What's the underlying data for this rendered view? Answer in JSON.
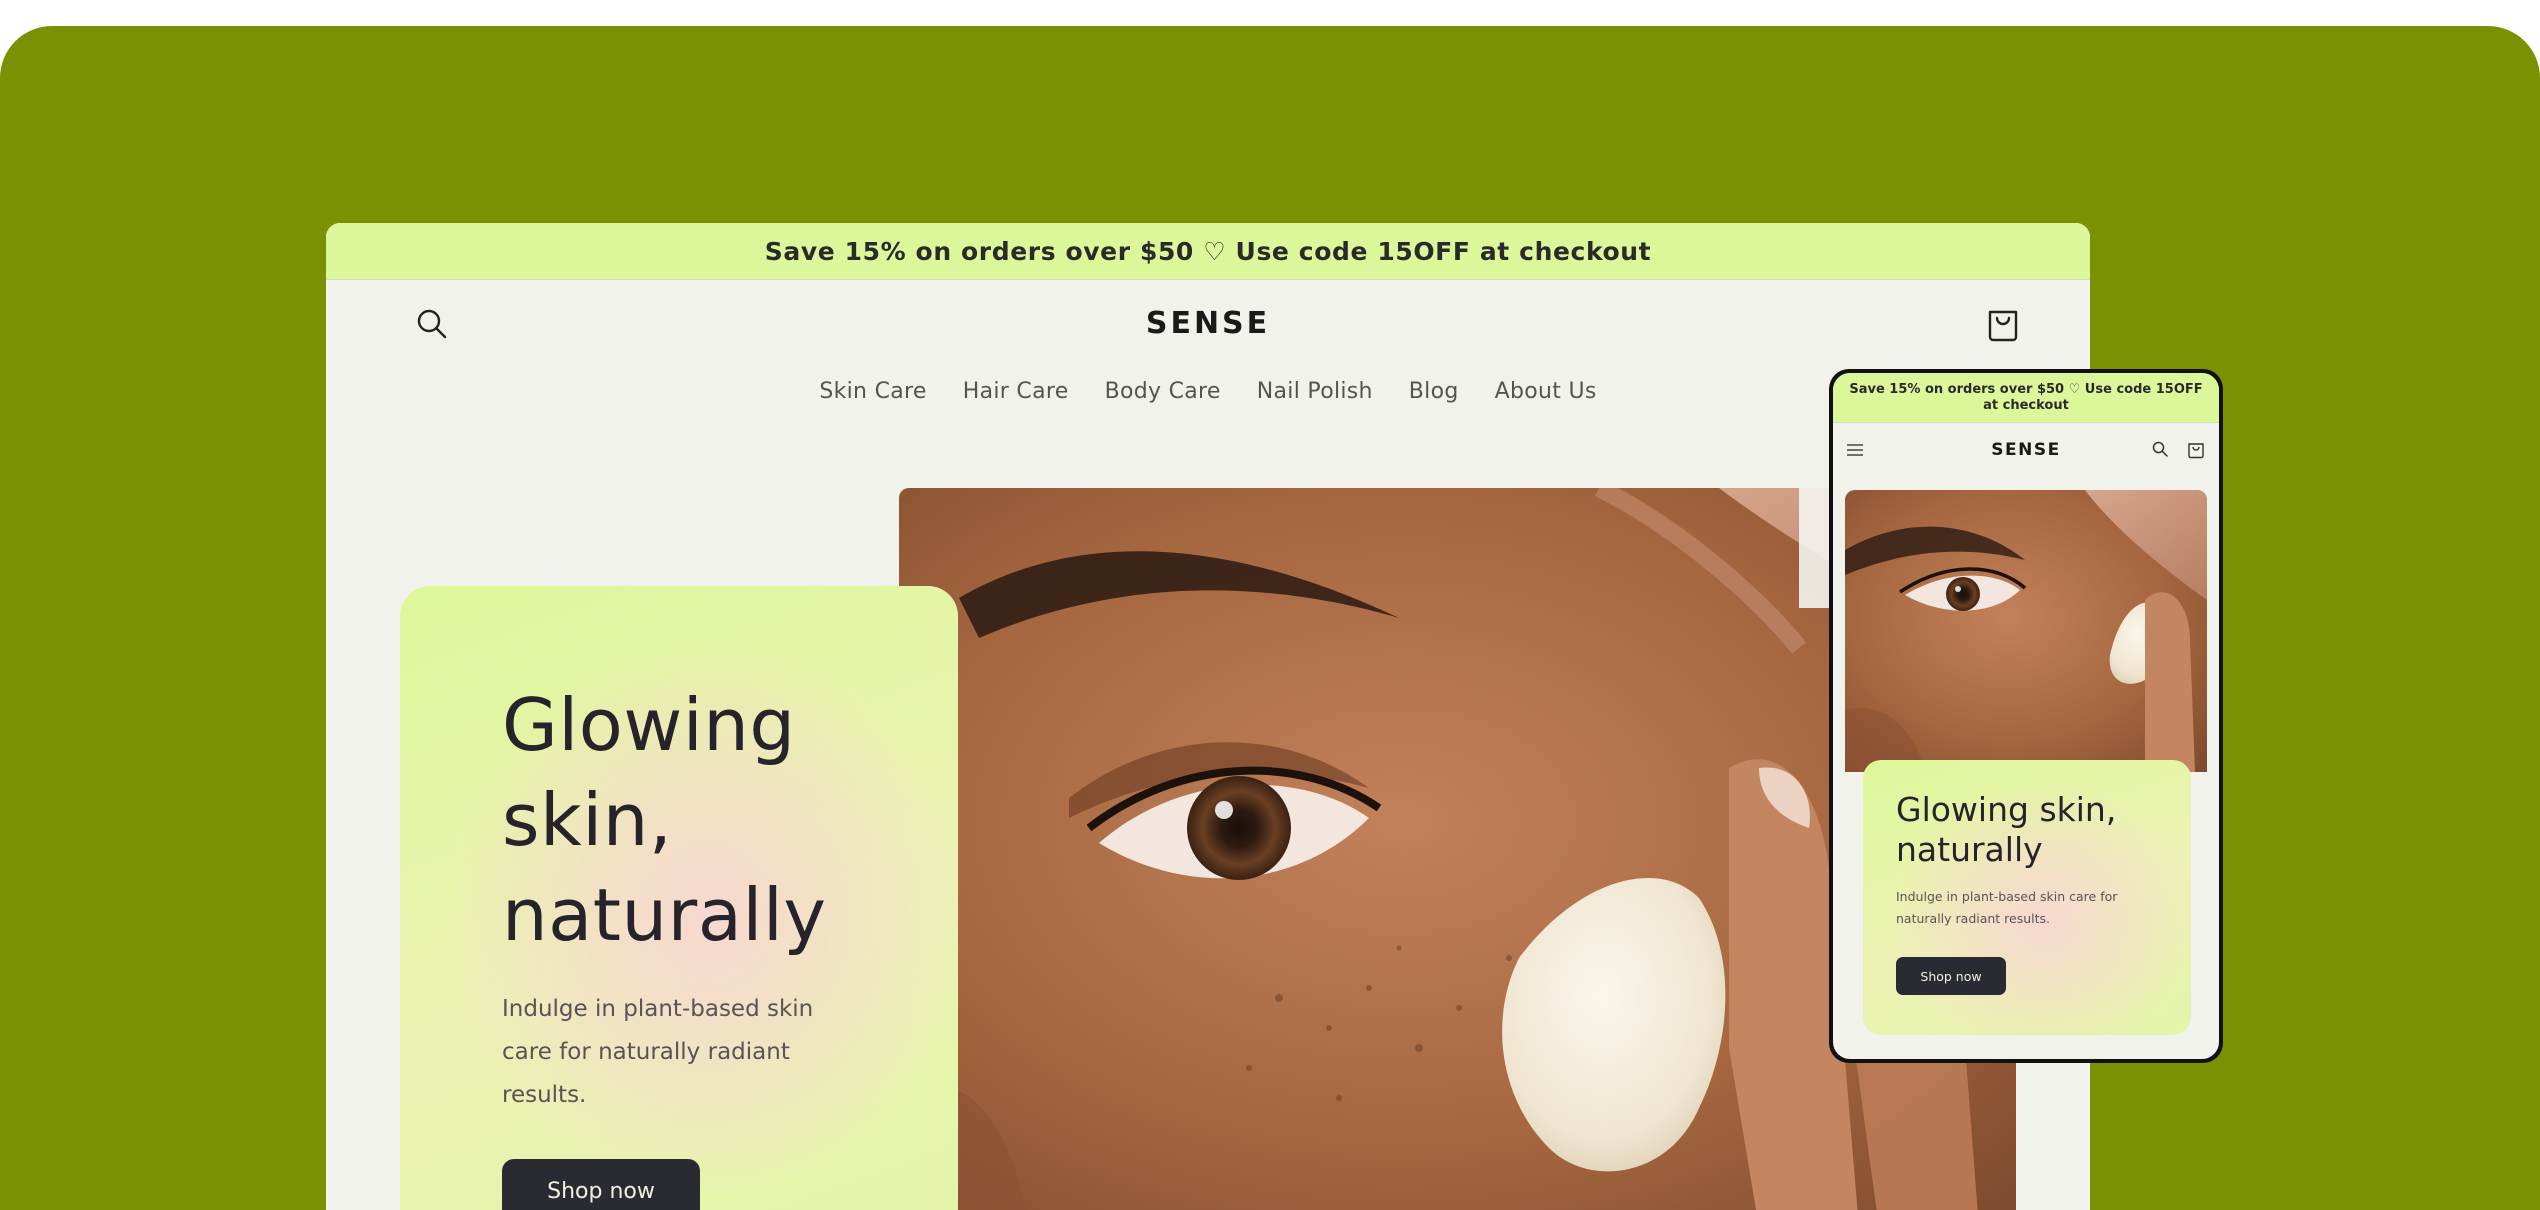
{
  "colors": {
    "stage_background": "#7b9104",
    "announcement_background": "#dcf799",
    "page_background": "#f1f2ec",
    "button_background": "#2a2a33",
    "button_text": "#f4f2df",
    "heading_text": "#26232a"
  },
  "desktop": {
    "announcement": "Save 15% on orders over $50 ♡ Use code 15OFF at checkout",
    "header": {
      "logo": "SENSE",
      "search_icon": "search-icon",
      "cart_icon": "cart-icon"
    },
    "nav": {
      "items": [
        "Skin Care",
        "Hair Care",
        "Body Care",
        "Nail Polish",
        "Blog",
        "About Us"
      ]
    },
    "hero": {
      "title": "Glowing skin, naturally",
      "subtitle": "Indulge in plant-based skin care for naturally radiant results.",
      "cta_label": "Shop now",
      "image": "close-up of face applying cream"
    }
  },
  "mobile": {
    "announcement": "Save 15% on orders over $50 ♡ Use code 15OFF at checkout",
    "header": {
      "logo": "SENSE",
      "menu_icon": "hamburger-menu-icon",
      "search_icon": "search-icon",
      "cart_icon": "cart-icon"
    },
    "hero": {
      "title": "Glowing skin, naturally",
      "subtitle": "Indulge in plant-based skin care for naturally radiant results.",
      "cta_label": "Shop now"
    }
  }
}
